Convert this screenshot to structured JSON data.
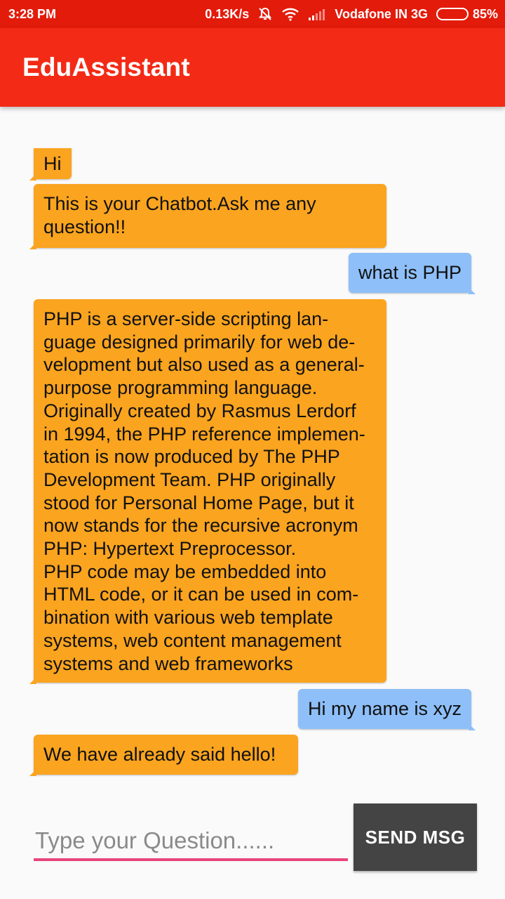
{
  "status_bar": {
    "time": "3:28 PM",
    "speed": "0.13K/s",
    "carrier": "Vodafone IN 3G",
    "battery": "85%",
    "battery_level": 0.85,
    "icons": [
      "mute-icon",
      "wifi-icon",
      "signal-icon",
      "battery-icon"
    ]
  },
  "app_bar": {
    "title": "EduAssistant"
  },
  "messages": [
    {
      "sender": "bot",
      "lines": [
        "Hi"
      ]
    },
    {
      "sender": "bot",
      "lines": [
        "This is your Chatbot.Ask me any",
        "question!!"
      ]
    },
    {
      "sender": "user",
      "lines": [
        "what is PHP"
      ]
    },
    {
      "sender": "bot",
      "lines": [
        "PHP is a server-side scripting lan-",
        "guage designed primarily for web de-",
        "velopment but also used as a general-",
        "purpose programming language.",
        "Originally created by Rasmus Lerdorf",
        "in 1994, the PHP reference implemen-",
        "tation is now produced by The PHP",
        "Development Team. PHP originally",
        "stood for Personal Home Page, but it",
        "now stands for the recursive acronym",
        "PHP: Hypertext Preprocessor.",
        "PHP code may be embedded into",
        "HTML code, or it can be used in com-",
        "bination with various web template",
        "systems, web content management",
        "systems and web frameworks"
      ]
    },
    {
      "sender": "user",
      "lines": [
        "Hi my name is xyz"
      ]
    },
    {
      "sender": "bot",
      "lines": [
        "We have already said hello!"
      ]
    }
  ],
  "input": {
    "placeholder": "Type your Question......",
    "value": ""
  },
  "send_button": {
    "label": "SEND MSG"
  },
  "colors": {
    "status_bar": "#e31b0b",
    "app_bar": "#f32a15",
    "bot_bubble": "#fba41f",
    "user_bubble": "#8ebff8",
    "input_underline": "#e8457a",
    "send_button": "#444444"
  }
}
